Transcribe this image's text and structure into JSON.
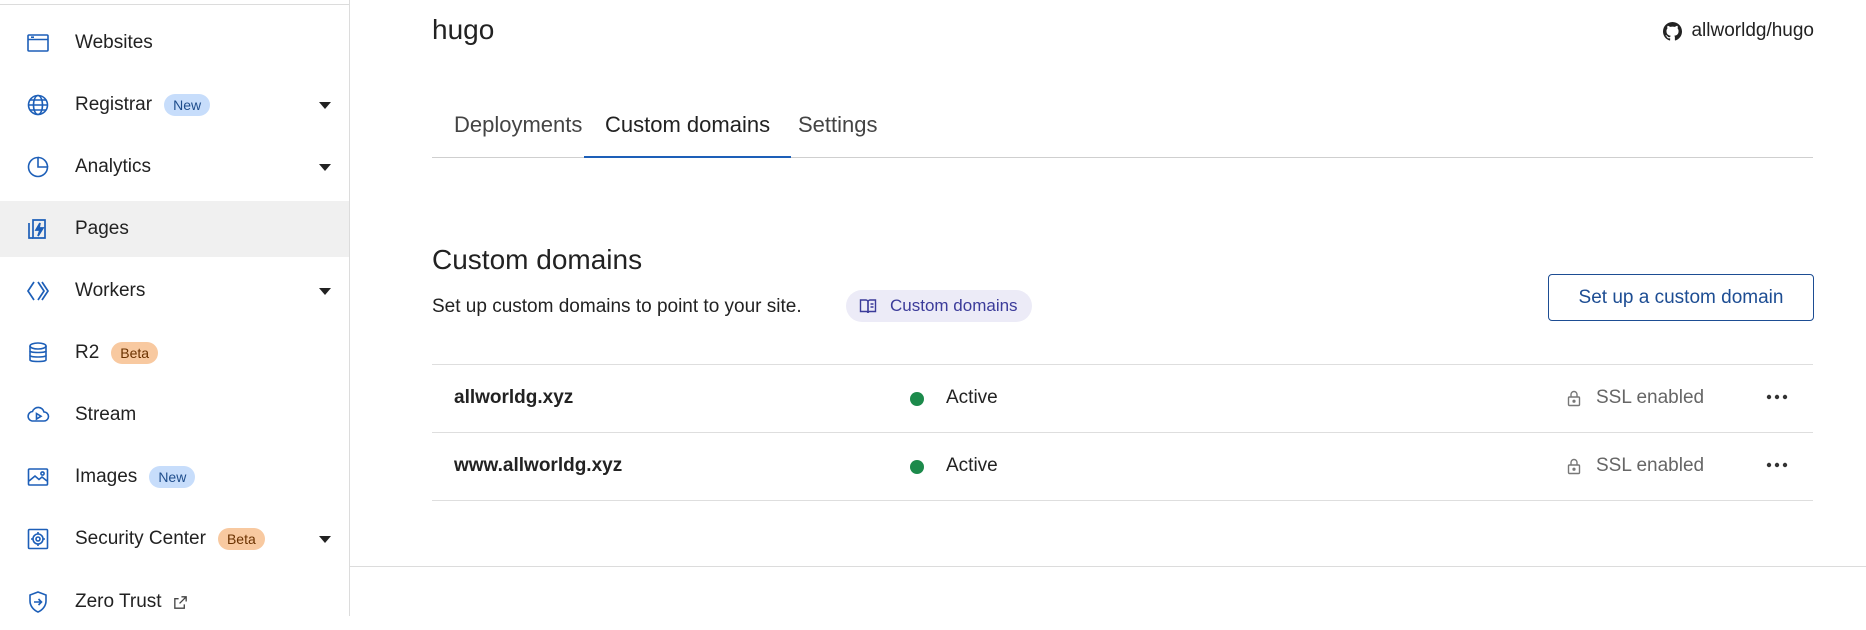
{
  "sidebar": {
    "items": [
      {
        "label": "Websites",
        "icon": "browser-window-icon",
        "badge": "",
        "badge_type": "",
        "has_caret": false,
        "external": false,
        "active": false
      },
      {
        "label": "Registrar",
        "icon": "globe-icon",
        "badge": "New",
        "badge_type": "new",
        "has_caret": true,
        "external": false,
        "active": false
      },
      {
        "label": "Analytics",
        "icon": "pie-chart-icon",
        "badge": "",
        "badge_type": "",
        "has_caret": true,
        "external": false,
        "active": false
      },
      {
        "label": "Pages",
        "icon": "lightning-page-icon",
        "badge": "",
        "badge_type": "",
        "has_caret": false,
        "external": false,
        "active": true
      },
      {
        "label": "Workers",
        "icon": "workers-icon",
        "badge": "",
        "badge_type": "",
        "has_caret": true,
        "external": false,
        "active": false
      },
      {
        "label": "R2",
        "icon": "database-icon",
        "badge": "Beta",
        "badge_type": "beta",
        "has_caret": false,
        "external": false,
        "active": false
      },
      {
        "label": "Stream",
        "icon": "cloud-play-icon",
        "badge": "",
        "badge_type": "",
        "has_caret": false,
        "external": false,
        "active": false
      },
      {
        "label": "Images",
        "icon": "image-icon",
        "badge": "New",
        "badge_type": "new",
        "has_caret": false,
        "external": false,
        "active": false
      },
      {
        "label": "Security Center",
        "icon": "security-center-icon",
        "badge": "Beta",
        "badge_type": "beta",
        "has_caret": true,
        "external": false,
        "active": false
      },
      {
        "label": "Zero Trust",
        "icon": "zero-trust-shield-icon",
        "badge": "",
        "badge_type": "",
        "has_caret": false,
        "external": true,
        "active": false
      }
    ]
  },
  "project": {
    "title": "hugo",
    "repo": "allworldg/hugo"
  },
  "tabs": [
    {
      "label": "Deployments",
      "active": false
    },
    {
      "label": "Custom domains",
      "active": true
    },
    {
      "label": "Settings",
      "active": false
    }
  ],
  "custom_domains": {
    "title": "Custom domains",
    "description": "Set up custom domains to point to your site.",
    "doc_link_label": "Custom domains",
    "setup_button_label": "Set up a custom domain",
    "rows": [
      {
        "domain": "allworldg.xyz",
        "status": "Active",
        "ssl": "SSL enabled"
      },
      {
        "domain": "www.allworldg.xyz",
        "status": "Active",
        "ssl": "SSL enabled"
      }
    ]
  },
  "colors": {
    "accent": "#1d5fb8",
    "button_border": "#1d4d93",
    "status_active": "#1c8a4b",
    "badge_new": "#c7ddfb",
    "badge_beta": "#f8c9a0",
    "icon_blue": "#1d5fb8"
  }
}
